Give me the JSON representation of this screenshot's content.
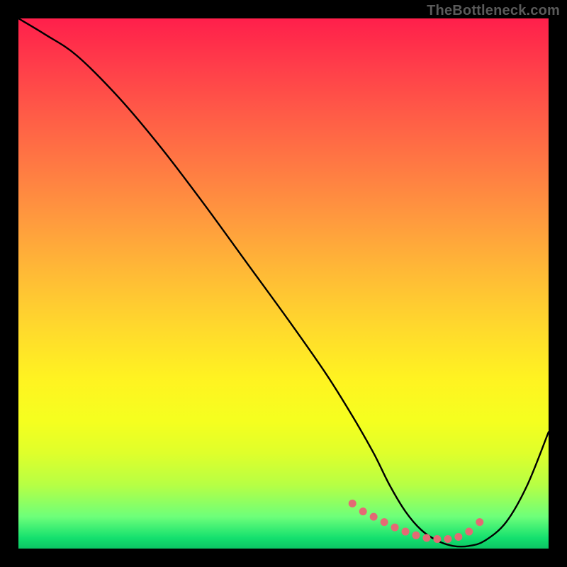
{
  "watermark": "TheBottleneck.com",
  "colors": {
    "background": "#000000",
    "curve": "#000000",
    "marker": "#e46a74",
    "gradient_top": "#ff1f4b",
    "gradient_bottom": "#0cc564"
  },
  "chart_data": {
    "type": "line",
    "title": "",
    "xlabel": "",
    "ylabel": "",
    "xlim": [
      0,
      100
    ],
    "ylim": [
      0,
      100
    ],
    "grid": false,
    "legend": false,
    "series": [
      {
        "name": "bottleneck-curve",
        "x": [
          0,
          5,
          11,
          19,
          27,
          35,
          43,
          51,
          58,
          63,
          67,
          70,
          73,
          76,
          79,
          82,
          85,
          88,
          92,
          96,
          100
        ],
        "values": [
          100,
          97,
          93,
          85,
          75.5,
          65,
          54,
          43,
          33,
          25,
          18,
          12,
          7,
          3.5,
          1.5,
          0.5,
          0.5,
          1.5,
          5,
          12,
          22
        ]
      }
    ],
    "markers": {
      "name": "highlighted-region",
      "x": [
        63,
        65,
        67,
        69,
        71,
        73,
        75,
        77,
        79,
        81,
        83,
        85,
        87
      ],
      "values": [
        8.5,
        7.0,
        6.0,
        5.0,
        4.0,
        3.2,
        2.5,
        2.0,
        1.8,
        1.8,
        2.2,
        3.2,
        5.0
      ]
    }
  }
}
